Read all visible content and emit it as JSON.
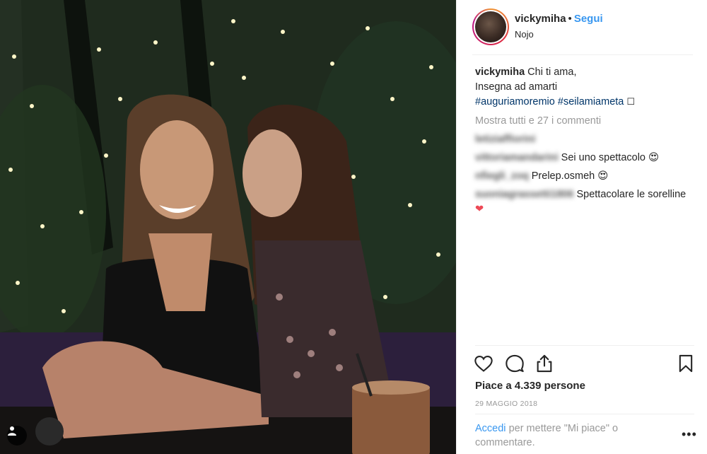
{
  "post": {
    "username": "vickymiha",
    "separator": "•",
    "follow_label": "Segui",
    "location": "Nojo",
    "caption_user": "vickymiha",
    "caption_line1": "Chi ti ama,",
    "caption_line2": "Insegna ad amarti",
    "hashtag1": "#auguriamoremio",
    "hashtag2": "#seilamiameta",
    "caption_end_glyph": "☐",
    "show_all_comments": "Mostra tutti e 27 i commenti",
    "comments": [
      {
        "user": "letiziaffiorini",
        "text": "",
        "emoji": ""
      },
      {
        "user": "vittoriamandarini",
        "text": "Sei uno spettacolo",
        "emoji": "😍"
      },
      {
        "user": "nfiegli_zoq",
        "text": "Prelep.osmeh",
        "emoji": "😍"
      },
      {
        "user": "suoniagrassetti1806",
        "text": "Spettacolare le sorelline",
        "emoji": "❤"
      }
    ],
    "likes": "Piace a 4.339 persone",
    "date": "29 MAGGIO 2018",
    "login_link": "Accedi",
    "login_text": "per mettere \"Mi piace\" o commentare.",
    "more_label": "•••"
  },
  "icons": [
    "heart-icon",
    "comment-icon",
    "share-icon",
    "bookmark-icon",
    "user-tag-icon"
  ]
}
